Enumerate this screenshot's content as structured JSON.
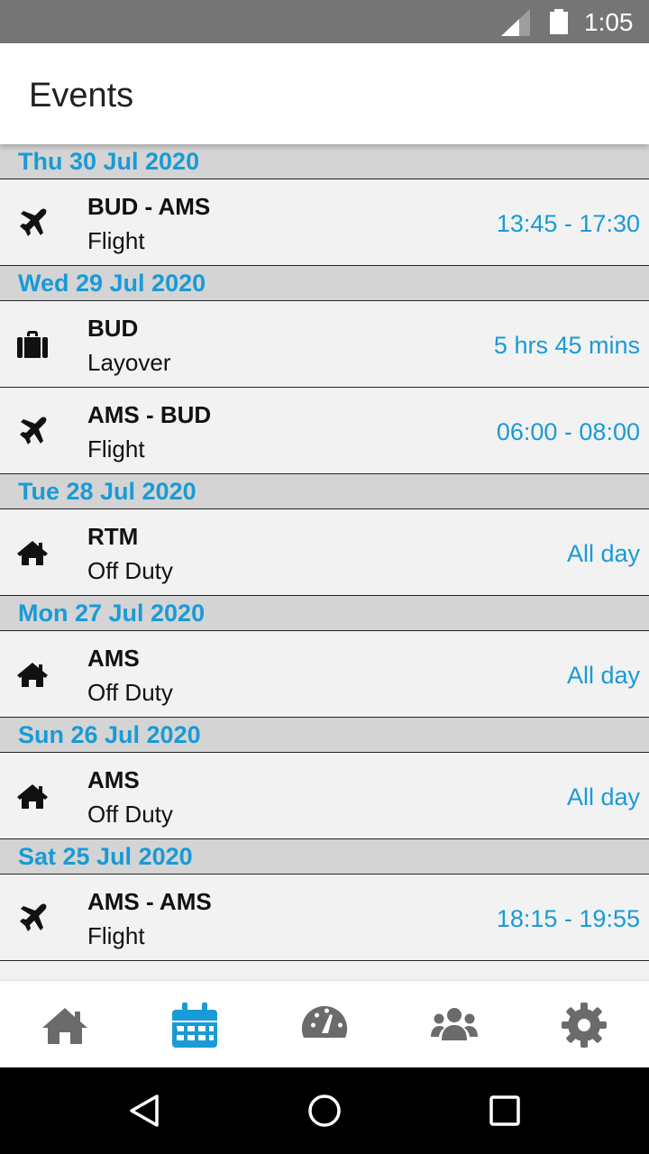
{
  "status_bar": {
    "time": "1:05",
    "icons": [
      "signal-icon",
      "battery-icon"
    ]
  },
  "app_bar": {
    "title": "Events"
  },
  "colors": {
    "accent": "#1a9ad6",
    "header_bg": "#d4d4d4",
    "row_bg": "#f2f2f2",
    "inactive_icon": "#6b6b6b"
  },
  "days": [
    {
      "date": "Thu 30 Jul 2020",
      "events": [
        {
          "icon": "airplane-icon",
          "location": "BUD - AMS",
          "type": "Flight",
          "time": "13:45 - 17:30"
        }
      ]
    },
    {
      "date": "Wed 29 Jul 2020",
      "events": [
        {
          "icon": "suitcase-icon",
          "location": "BUD",
          "type": "Layover",
          "time": "5 hrs 45 mins"
        },
        {
          "icon": "airplane-icon",
          "location": "AMS - BUD",
          "type": "Flight",
          "time": "06:00 - 08:00"
        }
      ]
    },
    {
      "date": "Tue 28 Jul 2020",
      "events": [
        {
          "icon": "home-icon",
          "location": "RTM",
          "type": "Off Duty",
          "time": "All day"
        }
      ]
    },
    {
      "date": "Mon 27 Jul 2020",
      "events": [
        {
          "icon": "home-icon",
          "location": "AMS",
          "type": "Off Duty",
          "time": "All day"
        }
      ]
    },
    {
      "date": "Sun 26 Jul 2020",
      "events": [
        {
          "icon": "home-icon",
          "location": "AMS",
          "type": "Off Duty",
          "time": "All day"
        }
      ]
    },
    {
      "date": "Sat 25 Jul 2020",
      "events": [
        {
          "icon": "airplane-icon",
          "location": "AMS - AMS",
          "type": "Flight",
          "time": "18:15 - 19:55"
        }
      ]
    }
  ],
  "bottom_nav": [
    {
      "name": "home",
      "icon": "home-icon",
      "active": false
    },
    {
      "name": "calendar",
      "icon": "calendar-icon",
      "active": true
    },
    {
      "name": "dashboard",
      "icon": "speedometer-icon",
      "active": false
    },
    {
      "name": "crew",
      "icon": "users-icon",
      "active": false
    },
    {
      "name": "settings",
      "icon": "gear-icon",
      "active": false
    }
  ],
  "system_nav": [
    "back-icon",
    "home-circle-icon",
    "recents-icon"
  ]
}
